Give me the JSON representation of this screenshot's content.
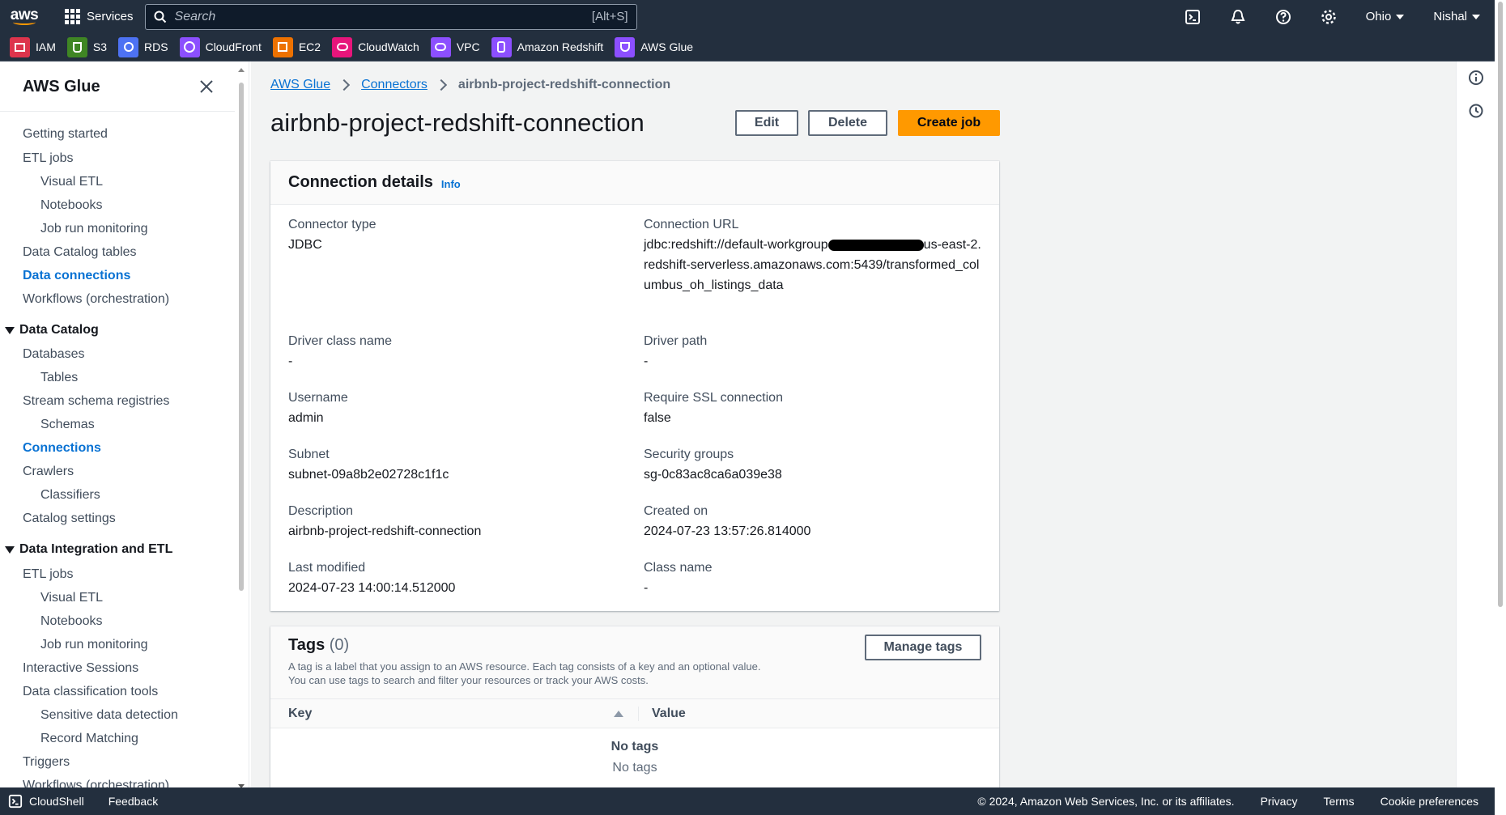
{
  "topnav": {
    "logo_text": "aws",
    "services_label": "Services",
    "search_placeholder": "Search",
    "search_shortcut": "[Alt+S]",
    "region": "Ohio",
    "user": "Nishal",
    "icons": [
      "cloudshell-icon",
      "notifications-icon",
      "help-icon",
      "settings-icon"
    ]
  },
  "favorites": [
    {
      "label": "IAM",
      "color": "#dd344c"
    },
    {
      "label": "S3",
      "color": "#3f8624"
    },
    {
      "label": "RDS",
      "color": "#4d72f3"
    },
    {
      "label": "CloudFront",
      "color": "#8c4fff"
    },
    {
      "label": "EC2",
      "color": "#ed7100"
    },
    {
      "label": "CloudWatch",
      "color": "#e7157b"
    },
    {
      "label": "VPC",
      "color": "#8c4fff"
    },
    {
      "label": "Amazon Redshift",
      "color": "#8c4fff"
    },
    {
      "label": "AWS Glue",
      "color": "#8c4fff"
    }
  ],
  "sidebar": {
    "title": "AWS Glue",
    "items": {
      "getting_started": "Getting started",
      "etl_jobs": "ETL jobs",
      "visual_etl": "Visual ETL",
      "notebooks": "Notebooks",
      "job_run_monitoring": "Job run monitoring",
      "data_catalog_tables": "Data Catalog tables",
      "data_connections": "Data connections",
      "workflows": "Workflows (orchestration)",
      "sec_data_catalog": "Data Catalog",
      "databases": "Databases",
      "tables": "Tables",
      "stream_schema": "Stream schema registries",
      "schemas": "Schemas",
      "connections": "Connections",
      "crawlers": "Crawlers",
      "classifiers": "Classifiers",
      "catalog_settings": "Catalog settings",
      "sec_data_integration": "Data Integration and ETL",
      "etl_jobs2": "ETL jobs",
      "visual_etl2": "Visual ETL",
      "notebooks2": "Notebooks",
      "job_run_monitoring2": "Job run monitoring",
      "interactive_sessions": "Interactive Sessions",
      "data_classification": "Data classification tools",
      "sensitive_data": "Sensitive data detection",
      "record_matching": "Record Matching",
      "triggers": "Triggers",
      "workflows2": "Workflows (orchestration)"
    }
  },
  "breadcrumb": {
    "root": "AWS Glue",
    "parent": "Connectors",
    "current": "airbnb-project-redshift-connection"
  },
  "page": {
    "title": "airbnb-project-redshift-connection",
    "edit": "Edit",
    "delete": "Delete",
    "create_job": "Create job"
  },
  "details": {
    "title": "Connection details",
    "info": "Info",
    "connector_type_label": "Connector type",
    "connector_type": "JDBC",
    "url_label": "Connection URL",
    "url_prefix": "jdbc:redshift://default-workgroup",
    "url_suffix": "us-east-2.redshift-serverless.amazonaws.com:5439/transformed_columbus_oh_listings_data",
    "driver_class_label": "Driver class name",
    "driver_class": "-",
    "driver_path_label": "Driver path",
    "driver_path": "-",
    "username_label": "Username",
    "username": "admin",
    "ssl_label": "Require SSL connection",
    "ssl": "false",
    "subnet_label": "Subnet",
    "subnet": "subnet-09a8b2e02728c1f1c",
    "sg_label": "Security groups",
    "sg": "sg-0c83ac8ca6a039e38",
    "description_label": "Description",
    "description": "airbnb-project-redshift-connection",
    "created_label": "Created on",
    "created": "2024-07-23 13:57:26.814000",
    "modified_label": "Last modified",
    "modified": "2024-07-23 14:00:14.512000",
    "class_label": "Class name",
    "class": "-"
  },
  "tags": {
    "title": "Tags",
    "count": "(0)",
    "desc1": "A tag is a label that you assign to an AWS resource. Each tag consists of a key and an optional value.",
    "desc2": "You can use tags to search and filter your resources or track your AWS costs.",
    "manage": "Manage tags",
    "col_key": "Key",
    "col_value": "Value",
    "empty_title": "No tags",
    "empty_sub": "No tags"
  },
  "footer": {
    "cloudshell": "CloudShell",
    "feedback": "Feedback",
    "copyright": "© 2024, Amazon Web Services, Inc. or its affiliates.",
    "privacy": "Privacy",
    "terms": "Terms",
    "cookies": "Cookie preferences"
  }
}
